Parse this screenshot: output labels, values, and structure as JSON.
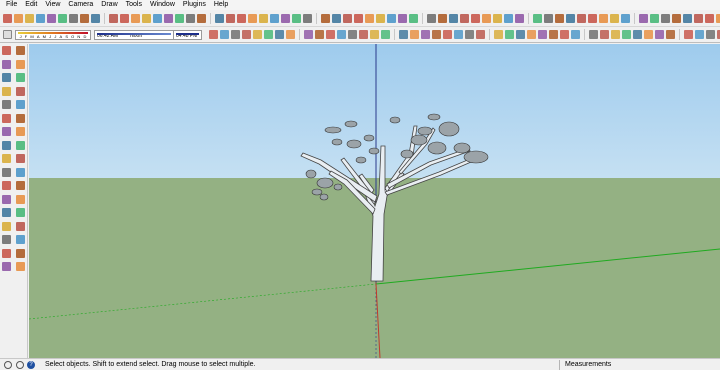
{
  "menu": [
    "File",
    "Edit",
    "View",
    "Camera",
    "Draw",
    "Tools",
    "Window",
    "Plugins",
    "Help"
  ],
  "shadow": {
    "months": [
      "J",
      "F",
      "M",
      "A",
      "M",
      "J",
      "J",
      "A",
      "S",
      "O",
      "N",
      "D"
    ],
    "time_start": "06:42 AM",
    "time_mid": "Noon",
    "time_end": "04:48 PM"
  },
  "status": {
    "hint": "Select objects. Shift to extend select. Drag mouse to select multiple.",
    "measurements_label": "Measurements"
  },
  "colors": {
    "sky_top": "#9ecbed",
    "ground": "#94b183",
    "blue_axis": "#2a3a8c",
    "green_axis": "#1faa1f",
    "red_axis": "#c0392b"
  }
}
